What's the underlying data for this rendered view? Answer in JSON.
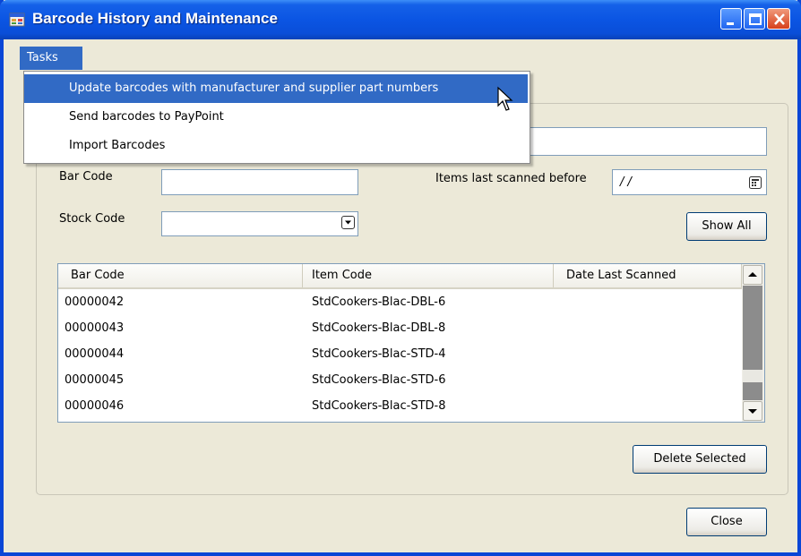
{
  "window": {
    "title": "Barcode History and Maintenance",
    "accent": "#0a4ed8",
    "highlight": "#316ac5"
  },
  "menubar": {
    "tasks_label": "Tasks"
  },
  "tasks_menu": {
    "items": [
      {
        "label": "Update barcodes with manufacturer and supplier part numbers"
      },
      {
        "label": "Send barcodes to PayPoint"
      },
      {
        "label": "Import Barcodes"
      }
    ]
  },
  "filters": {
    "bar_code_label": "Bar Code",
    "bar_code_value": "",
    "stock_code_label": "Stock Code",
    "stock_code_value": "",
    "last_scanned_label": "Items last scanned before",
    "last_scanned_value": "/ /",
    "search_value": ""
  },
  "buttons": {
    "show_all": "Show All",
    "delete_selected": "Delete Selected",
    "close": "Close"
  },
  "table": {
    "columns": [
      "Bar Code",
      "Item Code",
      "Date Last Scanned"
    ],
    "rows": [
      {
        "bar_code": "00000042",
        "item_code": "StdCookers-Blac-DBL-6",
        "date_last_scanned": ""
      },
      {
        "bar_code": "00000043",
        "item_code": "StdCookers-Blac-DBL-8",
        "date_last_scanned": ""
      },
      {
        "bar_code": "00000044",
        "item_code": "StdCookers-Blac-STD-4",
        "date_last_scanned": ""
      },
      {
        "bar_code": "00000045",
        "item_code": "StdCookers-Blac-STD-6",
        "date_last_scanned": ""
      },
      {
        "bar_code": "00000046",
        "item_code": "StdCookers-Blac-STD-8",
        "date_last_scanned": ""
      }
    ]
  },
  "icons": {
    "app": "app-window-icon",
    "calendar": "calendar-icon",
    "cursor": "mouse-pointer-icon"
  }
}
